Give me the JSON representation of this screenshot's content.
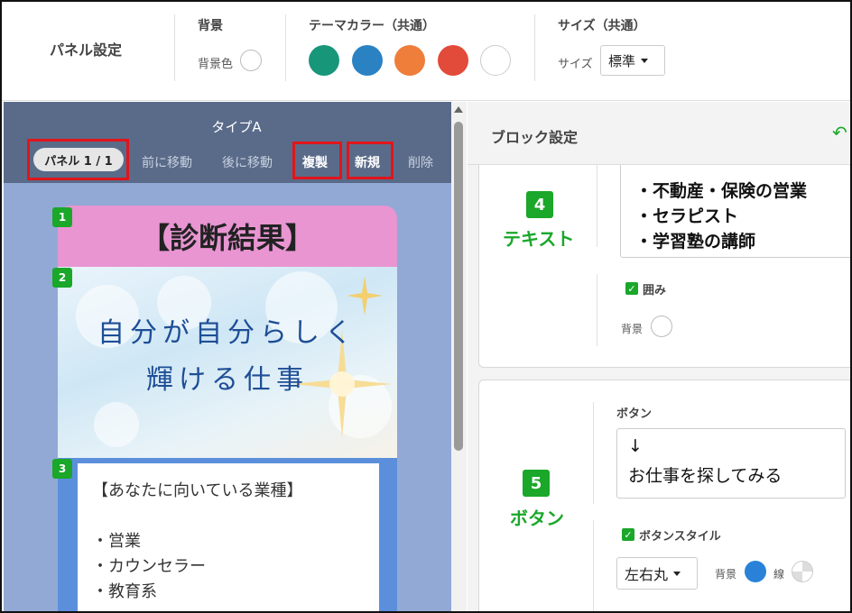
{
  "topbar": {
    "title": "パネル設定",
    "background": {
      "heading": "背景",
      "color_label": "背景色"
    },
    "theme": {
      "heading": "テーマカラー（共通）",
      "swatches": [
        "#17967a",
        "#2a82c3",
        "#ee7e3a",
        "#e24a3a",
        "#ffffff"
      ]
    },
    "size": {
      "heading": "サイズ（共通）",
      "label": "サイズ",
      "value": "標準"
    }
  },
  "preview": {
    "type_title": "タイプA",
    "panel_pill": "パネル 1 / 1",
    "move_prev": "前に移動",
    "move_next": "後に移動",
    "duplicate": "複製",
    "new": "新規",
    "delete": "削除",
    "card": {
      "heading": "【診断結果】",
      "image_line1": "自分が自分らしく",
      "image_line2": "輝ける仕事",
      "body_lines": [
        "【あなたに向いている業種】",
        "",
        "・営業",
        "・カウンセラー",
        "・教育系"
      ],
      "badges": [
        "1",
        "2",
        "3"
      ]
    }
  },
  "block_settings": {
    "title": "ブロック設定",
    "undo_icon": "undo-icon",
    "text_block": {
      "number": "4",
      "label": "テキスト",
      "lines": [
        "・不動産・保険の営業",
        "・セラピスト",
        "・学習塾の講師"
      ],
      "frame_label": "囲み",
      "bg_label": "背景"
    },
    "button_block": {
      "number": "5",
      "label": "ボタン",
      "field_label": "ボタン",
      "text_line1": "↓",
      "text_line2": "お仕事を探してみる",
      "style_label": "ボタンスタイル",
      "shape_value": "左右丸",
      "bg_label": "背景",
      "line_label": "線",
      "bg_color": "#2a82d8"
    }
  }
}
